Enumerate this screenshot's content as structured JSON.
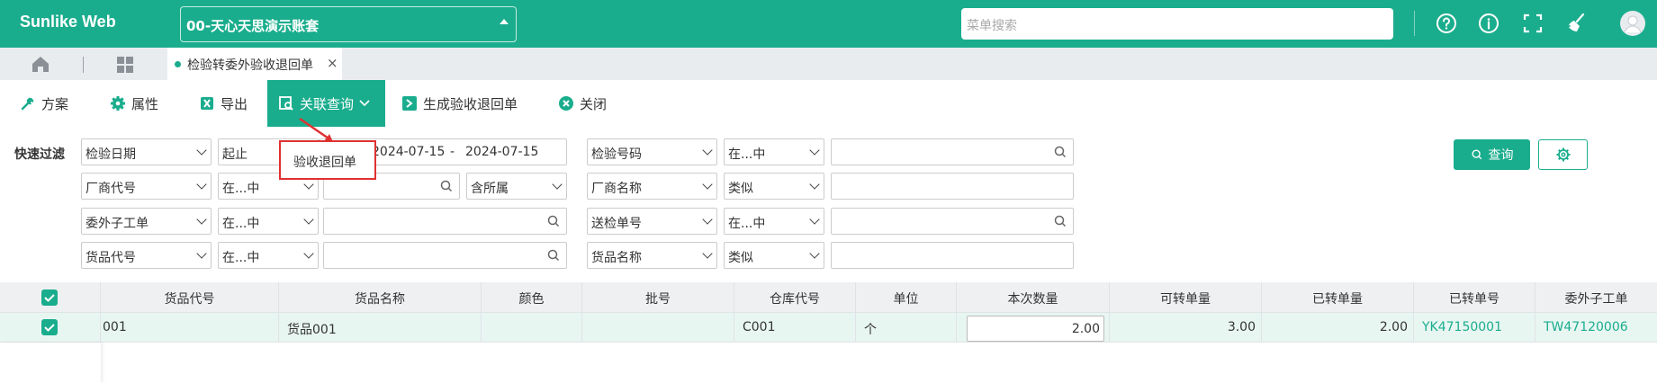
{
  "app": {
    "logo": "Sunlike Web",
    "account": "00-天心天思演示账套",
    "search_placeholder": "菜单搜索"
  },
  "header_icons": [
    "help-icon",
    "info-icon",
    "fullscreen-icon",
    "broom-icon",
    "user-avatar-icon"
  ],
  "tabs": {
    "active_label": "检验转委外验收退回单",
    "close": "×"
  },
  "toolbar": {
    "scheme": "方案",
    "properties": "属性",
    "export": "导出",
    "related_query": "关联查询",
    "generate": "生成验收退回单",
    "close": "关闭"
  },
  "popup": {
    "item": "验收退回单"
  },
  "filter": {
    "label": "快速过滤",
    "rows": [
      {
        "field1": "检验日期",
        "op1": "起止",
        "date_from": "2024-07-15",
        "date_sep": "-",
        "date_to": "2024-07-15",
        "field2": "检验号码",
        "op2": "在...中",
        "value2": ""
      },
      {
        "field1": "厂商代号",
        "op1": "在...中",
        "value1": "",
        "extra": "含所属",
        "field2": "厂商名称",
        "op2": "类似",
        "value2": ""
      },
      {
        "field1": "委外子工单",
        "op1": "在...中",
        "value1": "",
        "field2": "送检单号",
        "op2": "在...中",
        "value2": ""
      },
      {
        "field1": "货品代号",
        "op1": "在...中",
        "value1": "",
        "field2": "货品名称",
        "op2": "类似",
        "value2": ""
      }
    ],
    "query_button": "查询"
  },
  "table": {
    "columns": [
      "货品代号",
      "货品名称",
      "颜色",
      "批号",
      "仓库代号",
      "单位",
      "本次数量",
      "可转单量",
      "已转单量",
      "已转单号",
      "委外子工单"
    ],
    "rows": [
      {
        "item_code": "001",
        "item_name": "货品001",
        "color": "",
        "batch": "",
        "warehouse": "C001",
        "unit": "个",
        "qty": "2.00",
        "transferable": "3.00",
        "transferred": "2.00",
        "transferred_no": "YK47150001",
        "sub_order": "TW47120006"
      }
    ]
  },
  "colors": {
    "accent": "#1aad8d",
    "highlight_border": "#e03131",
    "row_selected": "#e8f6f2"
  }
}
